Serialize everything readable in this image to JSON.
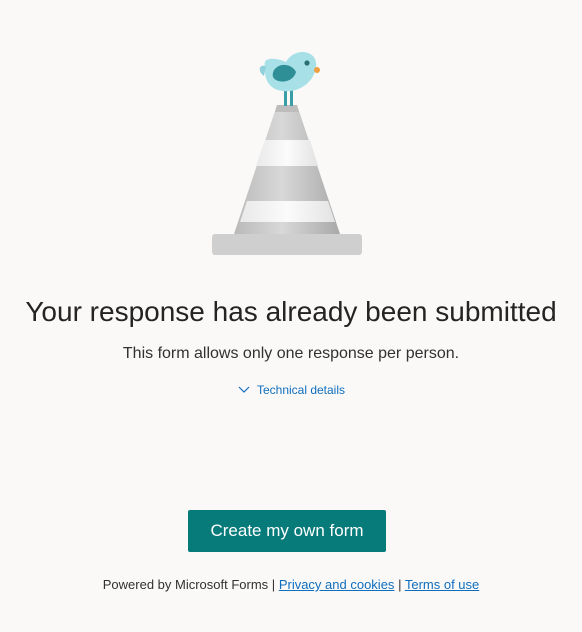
{
  "illustration": {
    "icon": "bird-on-traffic-cone-icon",
    "colors": {
      "cone_gray": "#c8c8c8",
      "cone_stripe": "#f4f4f4",
      "bird_body": "#a8e0e8",
      "bird_wing": "#2f8f96",
      "bird_beak": "#f0a040"
    }
  },
  "message": {
    "title": "Your response has already been submitted",
    "subtitle": "This form allows only one response per person.",
    "technical_details_label": "Technical details"
  },
  "actions": {
    "create_form_label": "Create my own form"
  },
  "footer": {
    "powered_by": "Powered by Microsoft Forms",
    "separator": "|",
    "privacy_link": "Privacy and cookies",
    "terms_link": "Terms of use"
  },
  "colors": {
    "background": "#faf9f8",
    "accent_button": "#077a7a",
    "link": "#106ebe"
  }
}
